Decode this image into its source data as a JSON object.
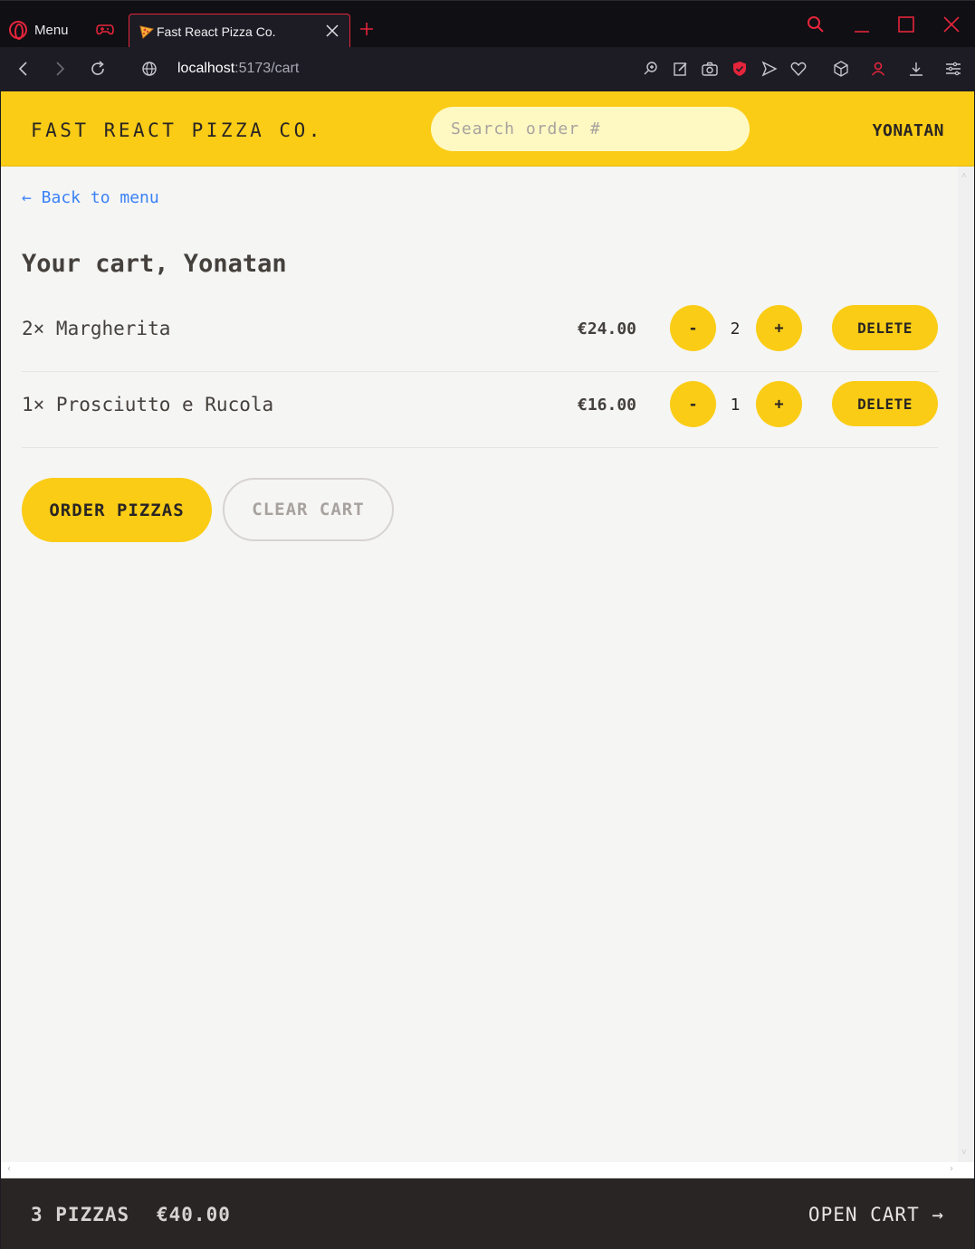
{
  "browser": {
    "menu_label": "Menu",
    "tab_title": "Fast React Pizza Co.",
    "url_host": "localhost",
    "url_rest": ":5173/cart",
    "accent_color": "#e5253b"
  },
  "header": {
    "brand": "FAST REACT PIZZA CO.",
    "search_placeholder": "Search order #",
    "username": "YONATAN"
  },
  "cart": {
    "back_link": "← Back to menu",
    "title": "Your cart, Yonatan",
    "items": [
      {
        "name": "2× Margherita",
        "price": "€24.00",
        "minus": "-",
        "quantity": "2",
        "plus": "+",
        "delete": "DELETE"
      },
      {
        "name": "1× Prosciutto e Rucola",
        "price": "€16.00",
        "minus": "-",
        "quantity": "1",
        "plus": "+",
        "delete": "DELETE"
      }
    ],
    "order_button": "ORDER PIZZAS",
    "clear_button": "CLEAR CART"
  },
  "footer": {
    "pizza_count": "3 PIZZAS",
    "total": "€40.00",
    "open_cart": "OPEN CART →"
  },
  "colors": {
    "primary_yellow": "#facc15",
    "link_blue": "#3b82f6",
    "footer_dark": "#292524"
  }
}
